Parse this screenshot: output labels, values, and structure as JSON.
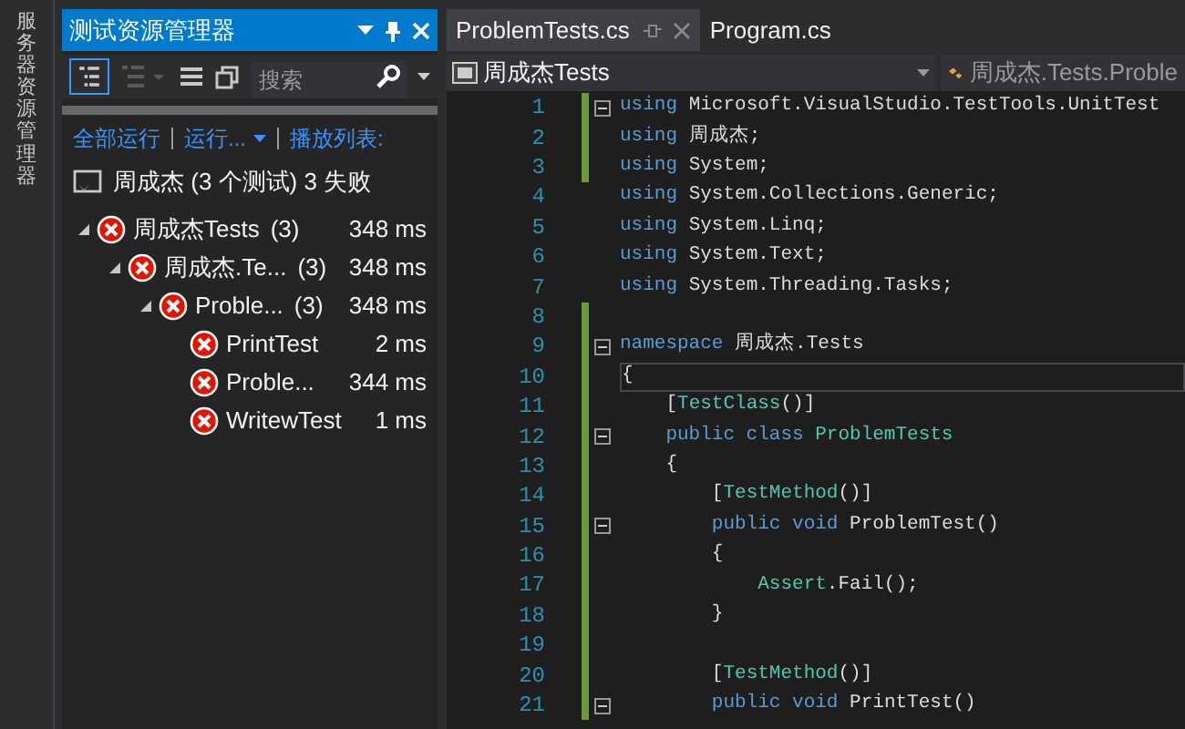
{
  "side_strip": {
    "label": "服务器资源管理器"
  },
  "test_explorer": {
    "title": "测试资源管理器",
    "search": {
      "placeholder": "搜索"
    },
    "actions": [
      {
        "label": "全部运行",
        "dropdown": false
      },
      {
        "label": "运行...",
        "dropdown": true
      },
      {
        "label": "播放列表:",
        "dropdown": false
      }
    ],
    "summary": "周成杰 (3 个测试) 3 失败",
    "tree": [
      {
        "name": "周成杰Tests",
        "count": "(3)",
        "time": "348 ms",
        "kind": "failed",
        "expanded": true,
        "children": [
          {
            "name": "周成杰.Te...",
            "count": "(3)",
            "time": "348 ms",
            "kind": "failed",
            "expanded": true,
            "children": [
              {
                "name": "Proble...",
                "count": "(3)",
                "time": "348 ms",
                "kind": "failed",
                "expanded": true,
                "children": [
                  {
                    "name": "PrintTest",
                    "time": "2 ms",
                    "kind": "failed"
                  },
                  {
                    "name": "Proble...",
                    "time": "344 ms",
                    "kind": "failed"
                  },
                  {
                    "name": "WritewTest",
                    "time": "1 ms",
                    "kind": "failed"
                  }
                ]
              }
            ]
          }
        ]
      }
    ]
  },
  "editor": {
    "tabs": [
      {
        "label": "ProblemTests.cs",
        "selected": true
      },
      {
        "label": "Program.cs",
        "selected": false
      }
    ],
    "nav": {
      "project": "周成杰Tests",
      "member": "周成杰.Tests.Proble"
    },
    "lines": [
      {
        "number": "1",
        "changed": true,
        "fold": true,
        "current": false,
        "tokens": [
          {
            "text": "using",
            "kind": "keyword"
          },
          {
            "text": " Microsoft.VisualStudio.TestTools.UnitTest",
            "kind": "plain"
          }
        ]
      },
      {
        "number": "2",
        "changed": true,
        "fold": false,
        "current": false,
        "tokens": [
          {
            "text": "using",
            "kind": "keyword"
          },
          {
            "text": " 周成杰;",
            "kind": "plain"
          }
        ]
      },
      {
        "number": "3",
        "changed": true,
        "fold": false,
        "current": false,
        "tokens": [
          {
            "text": "using",
            "kind": "keyword"
          },
          {
            "text": " System;",
            "kind": "plain"
          }
        ]
      },
      {
        "number": "4",
        "changed": false,
        "fold": false,
        "current": false,
        "tokens": [
          {
            "text": "using",
            "kind": "keyword"
          },
          {
            "text": " System.Collections.Generic;",
            "kind": "plain"
          }
        ]
      },
      {
        "number": "5",
        "changed": false,
        "fold": false,
        "current": false,
        "tokens": [
          {
            "text": "using",
            "kind": "keyword"
          },
          {
            "text": " System.Linq;",
            "kind": "plain"
          }
        ]
      },
      {
        "number": "6",
        "changed": false,
        "fold": false,
        "current": false,
        "tokens": [
          {
            "text": "using",
            "kind": "keyword"
          },
          {
            "text": " System.Text;",
            "kind": "plain"
          }
        ]
      },
      {
        "number": "7",
        "changed": false,
        "fold": false,
        "current": false,
        "tokens": [
          {
            "text": "using",
            "kind": "keyword"
          },
          {
            "text": " System.Threading.Tasks;",
            "kind": "plain"
          }
        ]
      },
      {
        "number": "8",
        "changed": true,
        "fold": false,
        "current": false
      },
      {
        "number": "9",
        "changed": true,
        "fold": true,
        "current": false,
        "tokens": [
          {
            "text": "namespace",
            "kind": "keyword"
          },
          {
            "text": " 周成杰.Tests",
            "kind": "plain"
          }
        ]
      },
      {
        "number": "10",
        "changed": true,
        "fold": false,
        "current": true,
        "tokens": [
          {
            "text": "{",
            "kind": "plain"
          }
        ]
      },
      {
        "number": "11",
        "changed": true,
        "fold": false,
        "current": false,
        "tokens": [
          {
            "text": "    [",
            "kind": "plain"
          },
          {
            "text": "TestClass",
            "kind": "type"
          },
          {
            "text": "()]",
            "kind": "plain"
          }
        ]
      },
      {
        "number": "12",
        "changed": true,
        "fold": true,
        "current": false,
        "tokens": [
          {
            "text": "    public class ",
            "kind": "keyword"
          },
          {
            "text": "ProblemTests",
            "kind": "type"
          }
        ]
      },
      {
        "number": "13",
        "changed": true,
        "fold": false,
        "current": false,
        "tokens": [
          {
            "text": "    {",
            "kind": "plain"
          }
        ]
      },
      {
        "number": "14",
        "changed": true,
        "fold": false,
        "current": false,
        "tokens": [
          {
            "text": "        [",
            "kind": "plain"
          },
          {
            "text": "TestMethod",
            "kind": "type"
          },
          {
            "text": "()]",
            "kind": "plain"
          }
        ]
      },
      {
        "number": "15",
        "changed": true,
        "fold": true,
        "current": false,
        "tokens": [
          {
            "text": "        public void",
            "kind": "keyword"
          },
          {
            "text": " ProblemTest()",
            "kind": "plain"
          }
        ]
      },
      {
        "number": "16",
        "changed": true,
        "fold": false,
        "current": false,
        "tokens": [
          {
            "text": "        {",
            "kind": "plain"
          }
        ]
      },
      {
        "number": "17",
        "changed": true,
        "fold": false,
        "current": false,
        "tokens": [
          {
            "text": "            Assert",
            "kind": "type"
          },
          {
            "text": ".Fail();",
            "kind": "plain"
          }
        ]
      },
      {
        "number": "18",
        "changed": true,
        "fold": false,
        "current": false,
        "tokens": [
          {
            "text": "        }",
            "kind": "plain"
          }
        ]
      },
      {
        "number": "19",
        "changed": true,
        "fold": false,
        "current": false
      },
      {
        "number": "20",
        "changed": true,
        "fold": false,
        "current": false,
        "tokens": [
          {
            "text": "        [",
            "kind": "plain"
          },
          {
            "text": "TestMethod",
            "kind": "type"
          },
          {
            "text": "()]",
            "kind": "plain"
          }
        ]
      },
      {
        "number": "21",
        "changed": true,
        "fold": true,
        "current": false,
        "tokens": [
          {
            "text": "        public void",
            "kind": "keyword"
          },
          {
            "text": " PrintTest()",
            "kind": "plain"
          }
        ]
      }
    ]
  }
}
